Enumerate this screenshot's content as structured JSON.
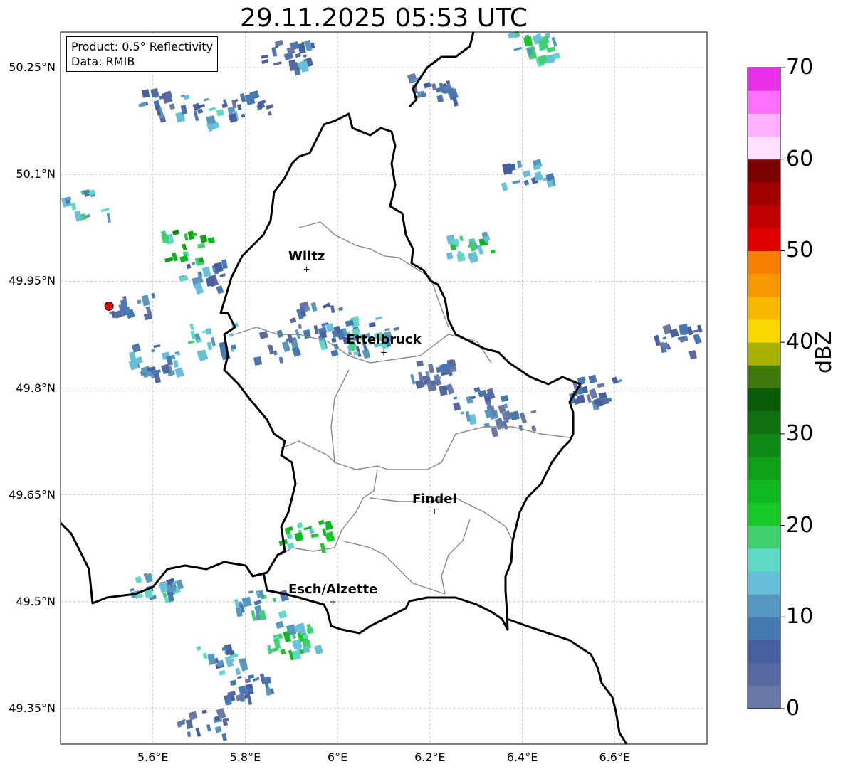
{
  "title": "29.11.2025 05:53 UTC",
  "info_box": {
    "product": "Product: 0.5° Reflectivity",
    "data": "Data: RMIB"
  },
  "axes": {
    "lat_ticks": [
      "50.25°N",
      "50.1°N",
      "49.95°N",
      "49.8°N",
      "49.65°N",
      "49.5°N",
      "49.35°N"
    ],
    "lon_ticks": [
      "5.6°E",
      "5.8°E",
      "6°E",
      "6.2°E",
      "6.4°E",
      "6.6°E"
    ],
    "lat_range": [
      49.3,
      50.3
    ],
    "lon_range": [
      5.4,
      6.8
    ]
  },
  "cities": [
    {
      "name": "Wiltz",
      "lat": 49.967,
      "lon": 5.933
    },
    {
      "name": "Ettelbruck",
      "lat": 49.85,
      "lon": 6.1
    },
    {
      "name": "Findel",
      "lat": 49.627,
      "lon": 6.21
    },
    {
      "name": "Esch/Alzette",
      "lat": 49.5,
      "lon": 5.99
    }
  ],
  "radar_site": {
    "lat": 49.915,
    "lon": 5.505,
    "color": "#e00000"
  },
  "colorbar": {
    "label": "dBZ",
    "min": 0,
    "max": 70,
    "ticks": [
      "0",
      "10",
      "20",
      "30",
      "40",
      "50",
      "60",
      "70"
    ],
    "colors": [
      "#6a78a8",
      "#5868a0",
      "#4860a0",
      "#4878b0",
      "#5898c0",
      "#68c0d8",
      "#60d8c8",
      "#40d070",
      "#18c828",
      "#10b820",
      "#10a018",
      "#108818",
      "#107010",
      "#0a5a0a",
      "#407810",
      "#a8b000",
      "#f8d800",
      "#f8b800",
      "#f89800",
      "#f88000",
      "#e00000",
      "#c00000",
      "#a00000",
      "#7a0000",
      "#ffe0ff",
      "#ffb0ff",
      "#ff70ff",
      "#e830e8"
    ]
  },
  "reflectivity_cells": [
    {
      "lat": 50.2,
      "lon": 5.62,
      "dbz": 8
    },
    {
      "lat": 50.19,
      "lon": 5.72,
      "dbz": 12
    },
    {
      "lat": 50.2,
      "lon": 5.8,
      "dbz": 6
    },
    {
      "lat": 50.06,
      "lon": 5.45,
      "dbz": 15
    },
    {
      "lat": 50.0,
      "lon": 5.67,
      "dbz": 22
    },
    {
      "lat": 49.96,
      "lon": 5.7,
      "dbz": 10
    },
    {
      "lat": 49.92,
      "lon": 5.55,
      "dbz": 5
    },
    {
      "lat": 49.87,
      "lon": 5.72,
      "dbz": 14
    },
    {
      "lat": 49.84,
      "lon": 5.6,
      "dbz": 9
    },
    {
      "lat": 49.86,
      "lon": 5.85,
      "dbz": 8
    },
    {
      "lat": 49.9,
      "lon": 5.95,
      "dbz": 7
    },
    {
      "lat": 49.87,
      "lon": 6.0,
      "dbz": 10
    },
    {
      "lat": 49.88,
      "lon": 6.07,
      "dbz": 13
    },
    {
      "lat": 49.82,
      "lon": 6.2,
      "dbz": 6
    },
    {
      "lat": 49.78,
      "lon": 6.3,
      "dbz": 8
    },
    {
      "lat": 49.76,
      "lon": 6.37,
      "dbz": 5
    },
    {
      "lat": 49.5,
      "lon": 5.82,
      "dbz": 14
    },
    {
      "lat": 49.45,
      "lon": 5.9,
      "dbz": 18
    },
    {
      "lat": 49.42,
      "lon": 5.74,
      "dbz": 11
    },
    {
      "lat": 49.38,
      "lon": 5.8,
      "dbz": 7
    },
    {
      "lat": 49.33,
      "lon": 5.7,
      "dbz": 6
    },
    {
      "lat": 49.52,
      "lon": 5.6,
      "dbz": 12
    },
    {
      "lat": 50.1,
      "lon": 6.4,
      "dbz": 9
    },
    {
      "lat": 50.0,
      "lon": 6.28,
      "dbz": 17
    },
    {
      "lat": 50.28,
      "lon": 6.42,
      "dbz": 16
    },
    {
      "lat": 50.22,
      "lon": 6.2,
      "dbz": 5
    },
    {
      "lat": 49.87,
      "lon": 6.73,
      "dbz": 4
    },
    {
      "lat": 49.8,
      "lon": 6.55,
      "dbz": 6
    },
    {
      "lat": 50.27,
      "lon": 5.88,
      "dbz": 8
    },
    {
      "lat": 49.6,
      "lon": 5.92,
      "dbz": 20
    }
  ]
}
